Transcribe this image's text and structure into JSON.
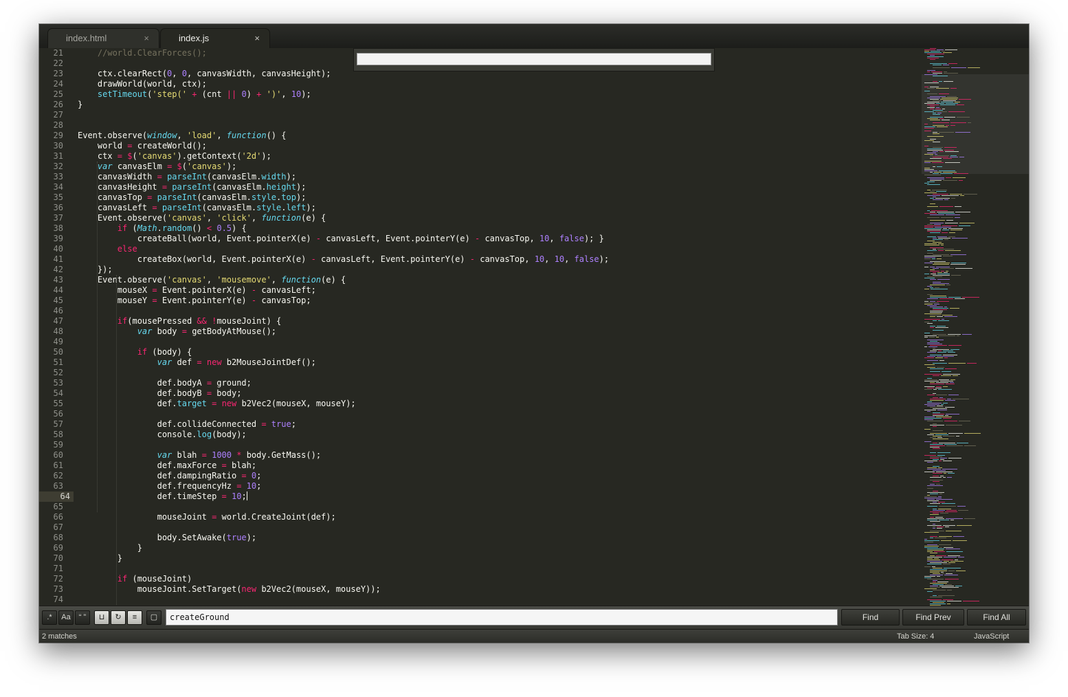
{
  "tabs": [
    {
      "label": "index.html",
      "close": "×"
    },
    {
      "label": "index.js",
      "close": "×"
    }
  ],
  "goto_input": {
    "value": ""
  },
  "lines": [
    {
      "n": "21",
      "html": "    <span class=\"cm\">//world.ClearForces();</span>"
    },
    {
      "n": "22",
      "html": ""
    },
    {
      "n": "23",
      "html": "    ctx.clearRect(<span class=\"nm\">0</span>, <span class=\"nm\">0</span>, canvasWidth, canvasHeight);"
    },
    {
      "n": "24",
      "html": "    drawWorld(world, ctx);"
    },
    {
      "n": "25",
      "html": "    <span class=\"sf\">setTimeout</span>(<span class=\"st\">'step('</span> <span class=\"kw\">+</span> (cnt <span class=\"kw\">||</span> <span class=\"nm\">0</span>) <span class=\"kw\">+</span> <span class=\"st\">')'</span>, <span class=\"nm\">10</span>);"
    },
    {
      "n": "26",
      "html": "}"
    },
    {
      "n": "27",
      "html": ""
    },
    {
      "n": "28",
      "html": ""
    },
    {
      "n": "29",
      "html": "Event.observe(<span class=\"si\">window</span>, <span class=\"st\">'load'</span>, <span class=\"si\">function</span>() {"
    },
    {
      "n": "30",
      "html": "    world <span class=\"kw\">=</span> createWorld();"
    },
    {
      "n": "31",
      "html": "    ctx <span class=\"kw\">=</span> <span class=\"kw\">$</span>(<span class=\"st\">'canvas'</span>).getContext(<span class=\"st\">'2d'</span>);"
    },
    {
      "n": "32",
      "html": "    <span class=\"si\">var</span> canvasElm <span class=\"kw\">=</span> <span class=\"kw\">$</span>(<span class=\"st\">'canvas'</span>);"
    },
    {
      "n": "33",
      "html": "    canvasWidth <span class=\"kw\">=</span> <span class=\"sf\">parseInt</span>(canvasElm.<span class=\"sf\">width</span>);"
    },
    {
      "n": "34",
      "html": "    canvasHeight <span class=\"kw\">=</span> <span class=\"sf\">parseInt</span>(canvasElm.<span class=\"sf\">height</span>);"
    },
    {
      "n": "35",
      "html": "    canvasTop <span class=\"kw\">=</span> <span class=\"sf\">parseInt</span>(canvasElm.<span class=\"sf\">style</span>.<span class=\"sf\">top</span>);"
    },
    {
      "n": "36",
      "html": "    canvasLeft <span class=\"kw\">=</span> <span class=\"sf\">parseInt</span>(canvasElm.<span class=\"sf\">style</span>.<span class=\"sf\">left</span>);"
    },
    {
      "n": "37",
      "html": "    Event.observe(<span class=\"st\">'canvas'</span>, <span class=\"st\">'click'</span>, <span class=\"si\">function</span>(e) {"
    },
    {
      "n": "38",
      "html": "        <span class=\"kw\">if</span> (<span class=\"si\">Math</span>.<span class=\"sf\">random</span>() <span class=\"kw\">&lt;</span> <span class=\"nm\">0.5</span>) {"
    },
    {
      "n": "39",
      "html": "            createBall(world, Event.pointerX(e) <span class=\"kw\">-</span> canvasLeft, Event.pointerY(e) <span class=\"kw\">-</span> canvasTop, <span class=\"nm\">10</span>, <span class=\"nm\">false</span>); }"
    },
    {
      "n": "40",
      "html": "        <span class=\"kw\">else</span>"
    },
    {
      "n": "41",
      "html": "            createBox(world, Event.pointerX(e) <span class=\"kw\">-</span> canvasLeft, Event.pointerY(e) <span class=\"kw\">-</span> canvasTop, <span class=\"nm\">10</span>, <span class=\"nm\">10</span>, <span class=\"nm\">false</span>);"
    },
    {
      "n": "42",
      "html": "    });"
    },
    {
      "n": "43",
      "html": "    Event.observe(<span class=\"st\">'canvas'</span>, <span class=\"st\">'mousemove'</span>, <span class=\"si\">function</span>(e) {"
    },
    {
      "n": "44",
      "html": "        mouseX <span class=\"kw\">=</span> Event.pointerX(e) <span class=\"kw\">-</span> canvasLeft;"
    },
    {
      "n": "45",
      "html": "        mouseY <span class=\"kw\">=</span> Event.pointerY(e) <span class=\"kw\">-</span> canvasTop;"
    },
    {
      "n": "46",
      "html": ""
    },
    {
      "n": "47",
      "html": "        <span class=\"kw\">if</span>(mousePressed <span class=\"kw\">&amp;&amp;</span> <span class=\"kw\">!</span>mouseJoint) {"
    },
    {
      "n": "48",
      "html": "            <span class=\"si\">var</span> body <span class=\"kw\">=</span> getBodyAtMouse();"
    },
    {
      "n": "49",
      "html": ""
    },
    {
      "n": "50",
      "html": "            <span class=\"kw\">if</span> (body) {"
    },
    {
      "n": "51",
      "html": "                <span class=\"si\">var</span> def <span class=\"kw\">=</span> <span class=\"kw\">new</span> b2MouseJointDef();"
    },
    {
      "n": "52",
      "html": ""
    },
    {
      "n": "53",
      "html": "                def.bodyA <span class=\"kw\">=</span> ground;"
    },
    {
      "n": "54",
      "html": "                def.bodyB <span class=\"kw\">=</span> body;"
    },
    {
      "n": "55",
      "html": "                def.<span class=\"sf\">target</span> <span class=\"kw\">=</span> <span class=\"kw\">new</span> b2Vec2(mouseX, mouseY);"
    },
    {
      "n": "56",
      "html": ""
    },
    {
      "n": "57",
      "html": "                def.collideConnected <span class=\"kw\">=</span> <span class=\"nm\">true</span>;"
    },
    {
      "n": "58",
      "html": "                console.<span class=\"sf\">log</span>(body);"
    },
    {
      "n": "59",
      "html": ""
    },
    {
      "n": "60",
      "html": "                <span class=\"si\">var</span> blah <span class=\"kw\">=</span> <span class=\"nm\">1000</span> <span class=\"kw\">*</span> body.GetMass();"
    },
    {
      "n": "61",
      "html": "                def.maxForce <span class=\"kw\">=</span> blah;"
    },
    {
      "n": "62",
      "html": "                def.dampingRatio <span class=\"kw\">=</span> <span class=\"nm\">0</span>;"
    },
    {
      "n": "63",
      "html": "                def.frequencyHz <span class=\"kw\">=</span> <span class=\"nm\">10</span>;"
    },
    {
      "n": "64",
      "html": "                def.timeStep <span class=\"kw\">=</span> <span class=\"nm\">10</span>;<span class=\"cursor\"></span>"
    },
    {
      "n": "65",
      "html": ""
    },
    {
      "n": "66",
      "html": "                mouseJoint <span class=\"kw\">=</span> world.CreateJoint(def);"
    },
    {
      "n": "67",
      "html": ""
    },
    {
      "n": "68",
      "html": "                body.SetAwake(<span class=\"nm\">true</span>);"
    },
    {
      "n": "69",
      "html": "            }"
    },
    {
      "n": "70",
      "html": "        }"
    },
    {
      "n": "71",
      "html": ""
    },
    {
      "n": "72",
      "html": "        <span class=\"kw\">if</span> (mouseJoint)"
    },
    {
      "n": "73",
      "html": "            mouseJoint.SetTarget(<span class=\"kw\">new</span> b2Vec2(mouseX, mouseY));"
    },
    {
      "n": "74",
      "html": ""
    }
  ],
  "current_line": "64",
  "findbar": {
    "toggles": [
      {
        "name": "regex-toggle",
        "glyph": ".*",
        "on": false
      },
      {
        "name": "case-toggle",
        "glyph": "Aa",
        "on": false
      },
      {
        "name": "whole-word-toggle",
        "glyph": "“ ”",
        "on": false
      },
      {
        "name": "highlight-toggle",
        "glyph": "⊔",
        "on": true
      },
      {
        "name": "wrap-toggle",
        "glyph": "↻",
        "on": true
      },
      {
        "name": "in-selection-toggle",
        "glyph": "≡",
        "on": true
      },
      {
        "name": "highlight-matches-toggle",
        "glyph": "▢",
        "on": false
      }
    ],
    "query": "createGround",
    "find_label": "Find",
    "find_prev_label": "Find Prev",
    "find_all_label": "Find All"
  },
  "status": {
    "matches": "2 matches",
    "tab_size": "Tab Size: 4",
    "syntax": "JavaScript"
  },
  "colors": {
    "background": "#272822",
    "keyword": "#f92672",
    "string": "#e6db74",
    "number": "#ae81ff",
    "function": "#66d9ef",
    "comment": "#75715e"
  }
}
